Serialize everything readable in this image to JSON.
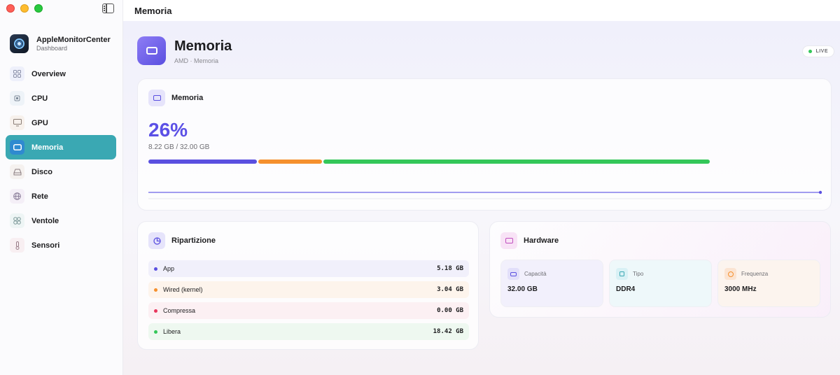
{
  "window": {
    "title": "Memoria"
  },
  "sidebar": {
    "app_name": "AppleMonitorCenter",
    "app_sub": "Dashboard",
    "items": [
      {
        "label": "Overview",
        "icon": "grid-icon"
      },
      {
        "label": "CPU",
        "icon": "cpu-icon"
      },
      {
        "label": "GPU",
        "icon": "display-icon"
      },
      {
        "label": "Memoria",
        "icon": "memory-icon",
        "active": true
      },
      {
        "label": "Disco",
        "icon": "disk-icon"
      },
      {
        "label": "Rete",
        "icon": "globe-icon"
      },
      {
        "label": "Ventole",
        "icon": "fan-icon"
      },
      {
        "label": "Sensori",
        "icon": "thermometer-icon"
      }
    ]
  },
  "page": {
    "title": "Memoria",
    "subtitle": "AMD · Memoria",
    "live_label": "LIVE"
  },
  "memory_card": {
    "title": "Memoria",
    "percent": "26%",
    "usage": "8.22 GB / 32.00 GB",
    "segments": [
      {
        "name": "App",
        "color": "#5a4fe0"
      },
      {
        "name": "Wired (kernel)",
        "color": "#f5902e"
      },
      {
        "name": "Libera",
        "color": "#34c759"
      }
    ]
  },
  "breakdown": {
    "title": "Ripartizione",
    "rows": [
      {
        "label": "App",
        "value": "5.18 GB",
        "color": "#5a4fe0"
      },
      {
        "label": "Wired (kernel)",
        "value": "3.04 GB",
        "color": "#f5902e"
      },
      {
        "label": "Compressa",
        "value": "0.00 GB",
        "color": "#e8365d"
      },
      {
        "label": "Libera",
        "value": "18.42 GB",
        "color": "#34c759"
      }
    ]
  },
  "hardware": {
    "title": "Hardware",
    "tiles": [
      {
        "label": "Capacità",
        "value": "32.00 GB"
      },
      {
        "label": "Tipo",
        "value": "DDR4"
      },
      {
        "label": "Frequenza",
        "value": "3000 MHz"
      }
    ]
  },
  "colors": {
    "accent": "#5b50e6",
    "sidebar_active": "#3aa8b3",
    "live": "#34c759"
  }
}
